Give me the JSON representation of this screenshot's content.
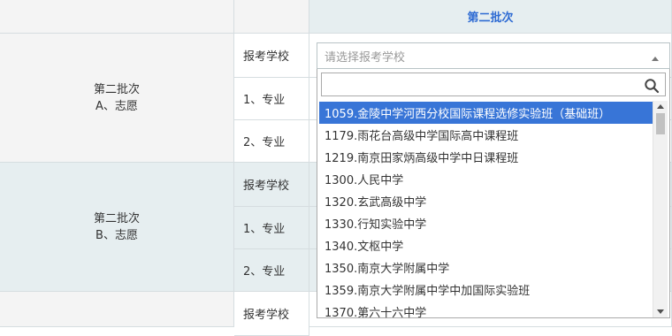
{
  "header": {
    "batch_title": "第二批次"
  },
  "groups": [
    {
      "label_line1": "第二批次",
      "label_line2": "A、志愿",
      "rows": [
        "报考学校",
        "1、专业",
        "2、专业"
      ]
    },
    {
      "label_line1": "第二批次",
      "label_line2": "B、志愿",
      "rows": [
        "报考学校",
        "1、专业",
        "2、专业"
      ]
    },
    {
      "rows": [
        "报考学校"
      ]
    }
  ],
  "school_select": {
    "placeholder": "请选择报考学校"
  },
  "dropdown": {
    "search_value": "",
    "options": [
      "1059.金陵中学河西分校国际课程选修实验班（基础班）",
      "1179.雨花台高级中学国际高中课程班",
      "1219.南京田家炳高级中学中日课程班",
      "1300.人民中学",
      "1320.玄武高级中学",
      "1330.行知实验中学",
      "1340.文枢中学",
      "1350.南京大学附属中学",
      "1359.南京大学附属中学中加国际实验班",
      "1370.第六十六中学"
    ],
    "selected_index": 0
  },
  "colors": {
    "accent": "#2e6bd3",
    "selected_bg": "#3875d7",
    "group_bg": "#e6eef0"
  },
  "icons": {
    "search": "search-icon",
    "select_arrow": "caret-up-icon"
  }
}
